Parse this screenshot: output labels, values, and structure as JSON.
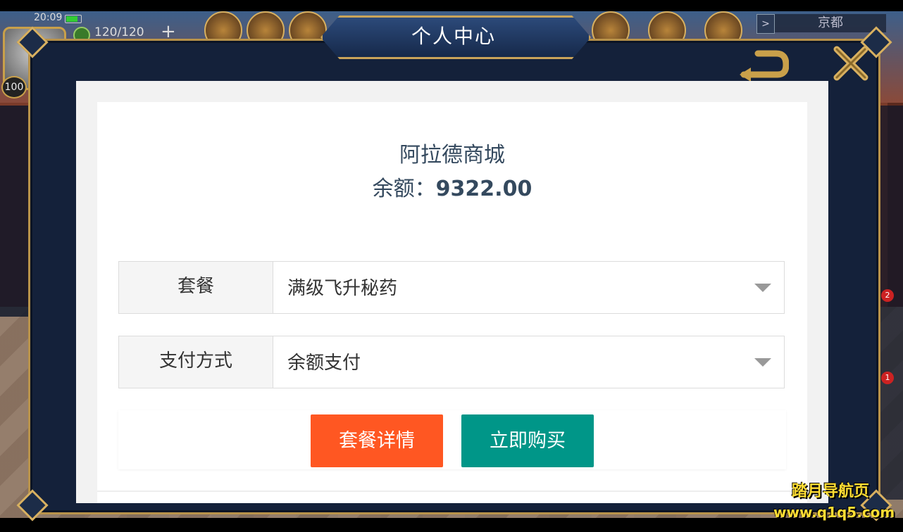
{
  "status": {
    "time": "20:09"
  },
  "player": {
    "energy": "120/120",
    "plus": "+",
    "level": "100"
  },
  "location": {
    "name": "京都",
    "toggle": ">"
  },
  "modal": {
    "title": "个人中心"
  },
  "shop": {
    "name": "阿拉德商城",
    "balance_label": "余额：",
    "balance_value": "9322.00"
  },
  "form": {
    "package": {
      "label": "套餐",
      "value": "满级飞升秘药"
    },
    "payment": {
      "label": "支付方式",
      "value": "余额支付"
    }
  },
  "buttons": {
    "details": "套餐详情",
    "buy": "立即购买"
  },
  "side_badges": [
    "2",
    "1"
  ],
  "watermark": {
    "line1": "踏月导航页",
    "line2": "www.q1q5.com"
  },
  "colors": {
    "orange": "#ff5722",
    "teal": "#009688",
    "frame_gold": "#b8924a",
    "frame_navy": "#14213a"
  }
}
